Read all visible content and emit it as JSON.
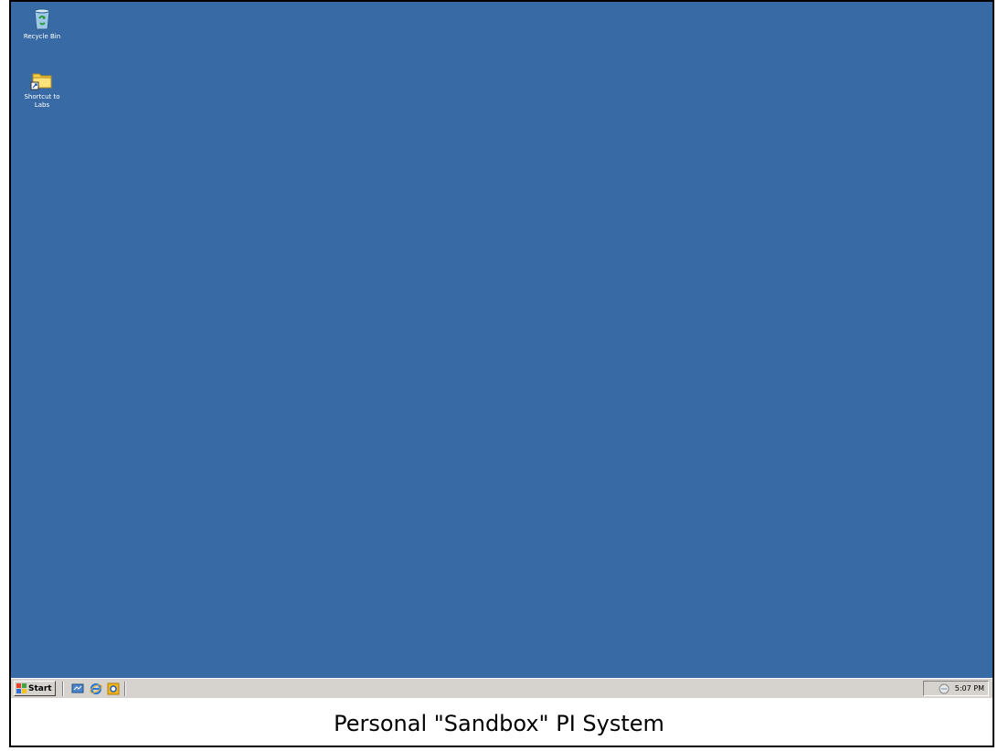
{
  "desktop": {
    "background_color": "#386ba6",
    "icons": [
      {
        "label": "Recycle Bin",
        "icon": "recycle-bin-icon"
      },
      {
        "label": "Shortcut to\nLabs",
        "icon": "folder-shortcut-icon"
      }
    ]
  },
  "taskbar": {
    "start_label": "Start",
    "quick_launch": [
      "show-desktop-icon",
      "internet-explorer-icon",
      "outlook-icon"
    ],
    "clock": "5:07 PM",
    "tray_icon": "network-icon"
  },
  "caption": "Personal \"Sandbox\" PI System"
}
